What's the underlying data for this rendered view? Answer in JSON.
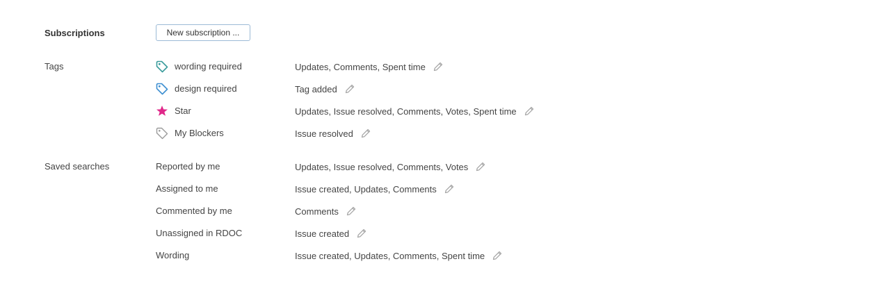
{
  "subscriptions": {
    "label": "Subscriptions",
    "new_button_label": "New subscription ..."
  },
  "tags": {
    "label": "Tags",
    "items": [
      {
        "name": "wording required",
        "events": "Updates, Comments, Spent time",
        "icon": "tag-icon",
        "color": "#3a9c9c"
      },
      {
        "name": "design required",
        "events": "Tag added",
        "icon": "tag-icon",
        "color": "#3d8fd1"
      },
      {
        "name": "Star",
        "events": "Updates, Issue resolved, Comments, Votes, Spent time",
        "icon": "star-icon",
        "color": "#e0288a"
      },
      {
        "name": "My Blockers",
        "events": "Issue resolved",
        "icon": "tag-icon",
        "color": "#9a9a9a"
      }
    ]
  },
  "saved_searches": {
    "label": "Saved searches",
    "items": [
      {
        "name": "Reported by me",
        "events": "Updates, Issue resolved, Comments, Votes"
      },
      {
        "name": "Assigned to me",
        "events": "Issue created, Updates, Comments"
      },
      {
        "name": "Commented by me",
        "events": "Comments"
      },
      {
        "name": "Unassigned in RDOC",
        "events": "Issue created"
      },
      {
        "name": "Wording",
        "events": "Issue created, Updates, Comments, Spent time"
      }
    ]
  },
  "colors": {
    "edit_icon": "#a8a8a8",
    "button_border": "#9cbad6"
  }
}
